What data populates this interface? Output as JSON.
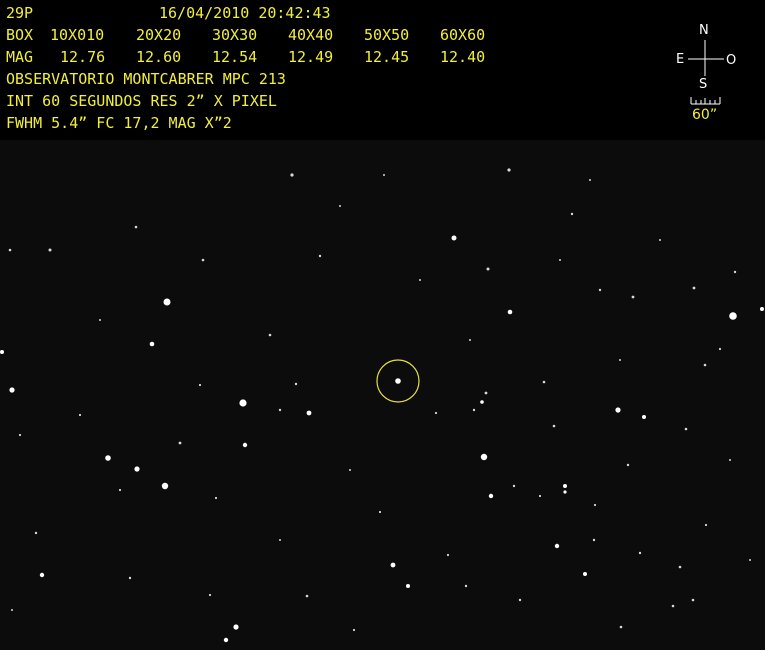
{
  "object": "29P",
  "datetime": "16/04/2010 20:42:43",
  "box_label": "BOX",
  "box_sizes": [
    "10X010",
    "20X20",
    "30X30",
    "40X40",
    "50X50",
    "60X60"
  ],
  "mag_label": "MAG",
  "mag_values": [
    "12.76",
    "12.60",
    "12.54",
    "12.49",
    "12.45",
    "12.40"
  ],
  "observatory": "OBSERVATORIO MONTCABRER MPC 213",
  "integration": "INT 60 SEGUNDOS RES 2” X PIXEL",
  "fwhm": "FWHM 5.4” FC 17,2 MAG X”2",
  "compass": {
    "north": "N",
    "south": "S",
    "east": "E",
    "west": "O",
    "scale": "60”"
  },
  "colors": {
    "text": "#f2ef3a",
    "marker": "#e6e23a",
    "background": "#0c0c0c"
  }
}
